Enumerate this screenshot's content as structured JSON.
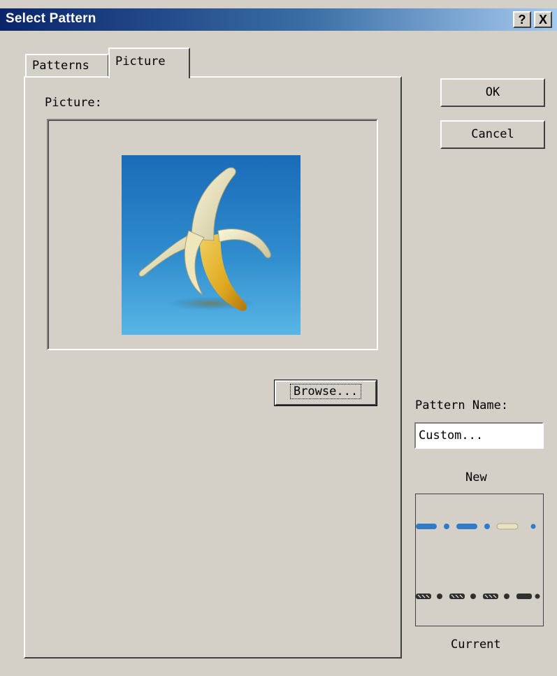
{
  "window": {
    "title": "Select Pattern",
    "help_button": "?",
    "close_button": "X"
  },
  "tabs": [
    {
      "label": "Patterns",
      "active": false
    },
    {
      "label": "Picture",
      "active": true
    }
  ],
  "picture_panel": {
    "label": "Picture:",
    "browse_button": "Browse...",
    "image_icon": "banana-image"
  },
  "actions": {
    "ok_label": "OK",
    "cancel_label": "Cancel"
  },
  "pattern": {
    "name_label": "Pattern Name:",
    "name_value": "Custom...",
    "new_label": "New",
    "current_label": "Current"
  },
  "colors": {
    "titlebar_start": "#0a246a",
    "titlebar_end": "#a6caf0",
    "dialog_bg": "#d4d0c8",
    "pattern_blue": "#2f7bc8"
  }
}
